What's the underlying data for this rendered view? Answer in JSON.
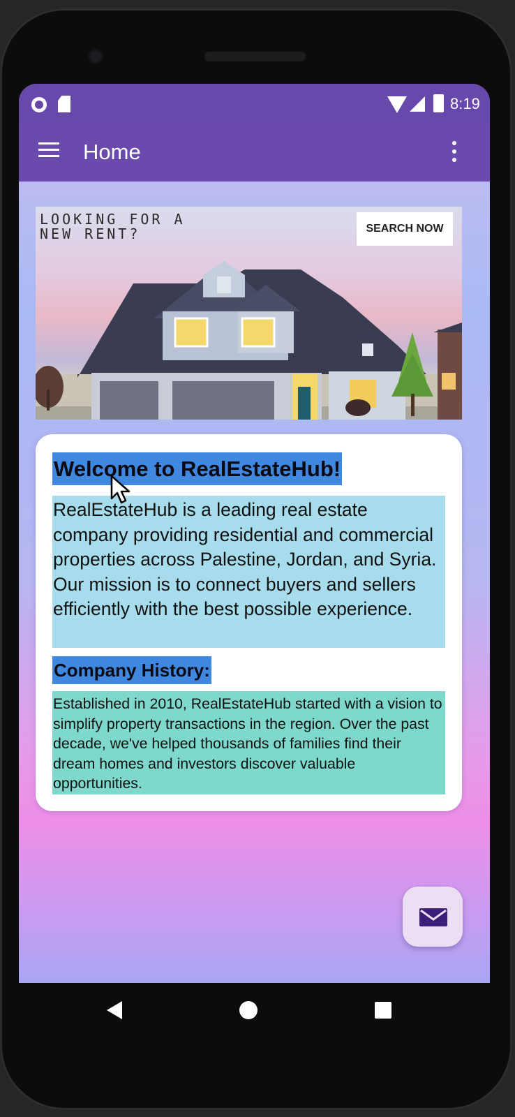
{
  "status_bar": {
    "time": "8:19"
  },
  "app_bar": {
    "title": "Home"
  },
  "banner": {
    "tagline": "LOOKING FOR A NEW RENT?",
    "button_label": "SEARCH NOW"
  },
  "card": {
    "welcome_title": "Welcome to RealEstateHub!",
    "intro_text": "RealEstateHub is a leading real estate company providing residential and commercial properties across Palestine, Jordan, and Syria. Our mission is to connect buyers and sellers efficiently with the best possible experience.",
    "history_title": "Company History:",
    "history_text": "Established in 2010, RealEstateHub started with a vision to simplify property transactions in the region. Over the past decade, we've helped thousands of families find their dream homes and investors discover valuable opportunities."
  },
  "fab": {
    "icon": "mail-icon"
  },
  "colors": {
    "app_bar": "#6a4aad",
    "status_bar": "#6748ab",
    "title_highlight": "#3f87df",
    "intro_highlight": "#a6dcec",
    "history_highlight": "#7fd8cc"
  }
}
